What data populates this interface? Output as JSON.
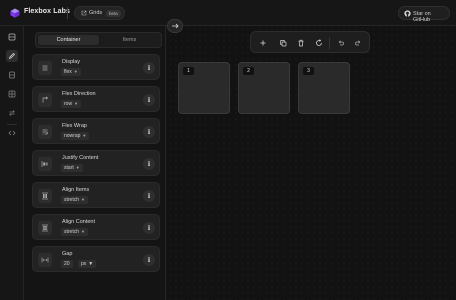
{
  "header": {
    "brand": "Flexbox Labs",
    "grids_label": "Grids",
    "beta_badge": "beta",
    "github_label": "Star on GitHub"
  },
  "rail": {
    "items": [
      "layout-icon",
      "pencil-icon",
      "database-icon",
      "grid-icon",
      "swap-icon",
      "code-icon"
    ]
  },
  "panel": {
    "tabs": [
      {
        "label": "Container",
        "active": true
      },
      {
        "label": "Items",
        "active": false
      }
    ],
    "properties": [
      {
        "label": "Display",
        "value": "flex"
      },
      {
        "label": "Flex Direction",
        "value": "row"
      },
      {
        "label": "Flex Wrap",
        "value": "nowrap"
      },
      {
        "label": "Justify Content",
        "value": "start"
      },
      {
        "label": "Align Items",
        "value": "stretch"
      },
      {
        "label": "Align Content",
        "value": "stretch"
      },
      {
        "label": "Gap",
        "value": "20",
        "unit": "px"
      }
    ]
  },
  "toolbar": {
    "tools": [
      "add-icon",
      "copy-icon",
      "trash-icon",
      "reset-icon",
      "undo-icon",
      "redo-icon"
    ]
  },
  "canvas": {
    "items": [
      {
        "label": "1"
      },
      {
        "label": "2"
      },
      {
        "label": "3"
      }
    ]
  },
  "colors": {
    "background": "#141414",
    "card": "#222222",
    "accent": "#8b5cf6"
  }
}
